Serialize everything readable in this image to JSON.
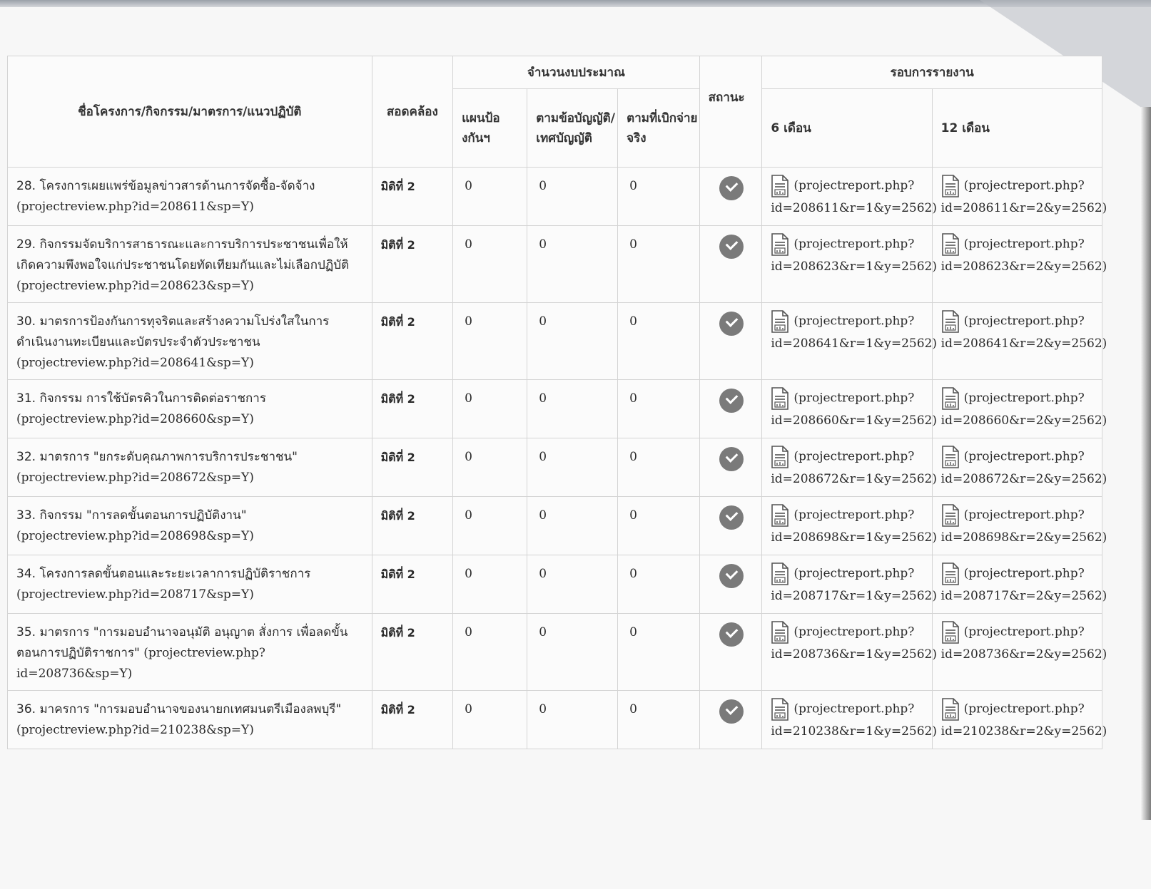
{
  "header": {
    "name_col": "ชื่อโครงการ/กิจกรรม/มาตรการ/แนวปฏิบัติ",
    "consistency_col": "สอดคล้อง",
    "budget_group": "จำนวนงบประมาณ",
    "budget_plan": "แผนป้องกันฯ",
    "budget_law": "ตามข้อบัญญัติ/เทศบัญญัติ",
    "budget_actual": "ตามที่เบิกจ่ายจริง",
    "status_col": "สถานะ",
    "report_group": "รอบการรายงาน",
    "report_6": "6 เดือน",
    "report_12": "12 เดือน"
  },
  "rows": [
    {
      "title": "28. โครงการเผยแพร่ข้อมูลข่าวสารด้านการจัดซื้อ-จัดจ้าง",
      "link": "(projectreview.php?id=208611&sp=Y)",
      "dimension": "มิติที่ 2",
      "plan": "0",
      "law": "0",
      "actual": "0",
      "r6": "(projectreport.php?id=208611&r=1&y=2562)",
      "r12": "(projectreport.php?id=208611&r=2&y=2562)"
    },
    {
      "title": "29. กิจกรรมจัดบริการสาธารณะและการบริการประชาชนเพื่อให้เกิดความพึงพอใจแก่ประชาชนโดยทัดเทียมกันและไม่เลือกปฏิบัติ",
      "link": "(projectreview.php?id=208623&sp=Y)",
      "dimension": "มิติที่ 2",
      "plan": "0",
      "law": "0",
      "actual": "0",
      "r6": "(projectreport.php?id=208623&r=1&y=2562)",
      "r12": "(projectreport.php?id=208623&r=2&y=2562)"
    },
    {
      "title": "30. มาตรการป้องกันการทุจริตและสร้างความโปร่งใสในการดำเนินงานทะเบียนและบัตรประจำตัวประชาชน",
      "link": "(projectreview.php?id=208641&sp=Y)",
      "dimension": "มิติที่ 2",
      "plan": "0",
      "law": "0",
      "actual": "0",
      "r6": "(projectreport.php?id=208641&r=1&y=2562)",
      "r12": "(projectreport.php?id=208641&r=2&y=2562)"
    },
    {
      "title": "31. กิจกรรม การใช้บัตรคิวในการติดต่อราชการ",
      "link": "(projectreview.php?id=208660&sp=Y)",
      "dimension": "มิติที่ 2",
      "plan": "0",
      "law": "0",
      "actual": "0",
      "r6": "(projectreport.php?id=208660&r=1&y=2562)",
      "r12": "(projectreport.php?id=208660&r=2&y=2562)"
    },
    {
      "title": "32. มาตรการ \"ยกระดับคุณภาพการบริการประชาชน\"",
      "link": "(projectreview.php?id=208672&sp=Y)",
      "dimension": "มิติที่ 2",
      "plan": "0",
      "law": "0",
      "actual": "0",
      "r6": "(projectreport.php?id=208672&r=1&y=2562)",
      "r12": "(projectreport.php?id=208672&r=2&y=2562)"
    },
    {
      "title": "33. กิจกรรม \"การลดขั้นตอนการปฏิบัติงาน\"",
      "link": "(projectreview.php?id=208698&sp=Y)",
      "dimension": "มิติที่ 2",
      "plan": "0",
      "law": "0",
      "actual": "0",
      "r6": "(projectreport.php?id=208698&r=1&y=2562)",
      "r12": "(projectreport.php?id=208698&r=2&y=2562)"
    },
    {
      "title": "34. โครงการลดขั้นตอนและระยะเวลาการปฏิบัติราชการ",
      "link": "(projectreview.php?id=208717&sp=Y)",
      "dimension": "มิติที่ 2",
      "plan": "0",
      "law": "0",
      "actual": "0",
      "r6": "(projectreport.php?id=208717&r=1&y=2562)",
      "r12": "(projectreport.php?id=208717&r=2&y=2562)"
    },
    {
      "title": "35. มาตรการ \"การมอบอำนาจอนุมัติ อนุญาต สั่งการ เพื่อลดขั้นตอนการปฏิบัติราชการ\"",
      "link": "(projectreview.php?id=208736&sp=Y)",
      "dimension": "มิติที่ 2",
      "plan": "0",
      "law": "0",
      "actual": "0",
      "r6": "(projectreport.php?id=208736&r=1&y=2562)",
      "r12": "(projectreport.php?id=208736&r=2&y=2562)"
    },
    {
      "title": "36. มาครการ \"การมอบอำนาจของนายกเทศมนตรีเมืองลพบุรี\"",
      "link": "(projectreview.php?id=210238&sp=Y)",
      "dimension": "มิติที่ 2",
      "plan": "0",
      "law": "0",
      "actual": "0",
      "r6": "(projectreport.php?id=210238&r=1&y=2562)",
      "r12": "(projectreport.php?id=210238&r=2&y=2562)"
    }
  ],
  "icons": {
    "status": "check-circle-icon",
    "report": "document-chart-icon"
  },
  "colors": {
    "check": "#7a7a7a",
    "border": "#d4d4d4"
  }
}
